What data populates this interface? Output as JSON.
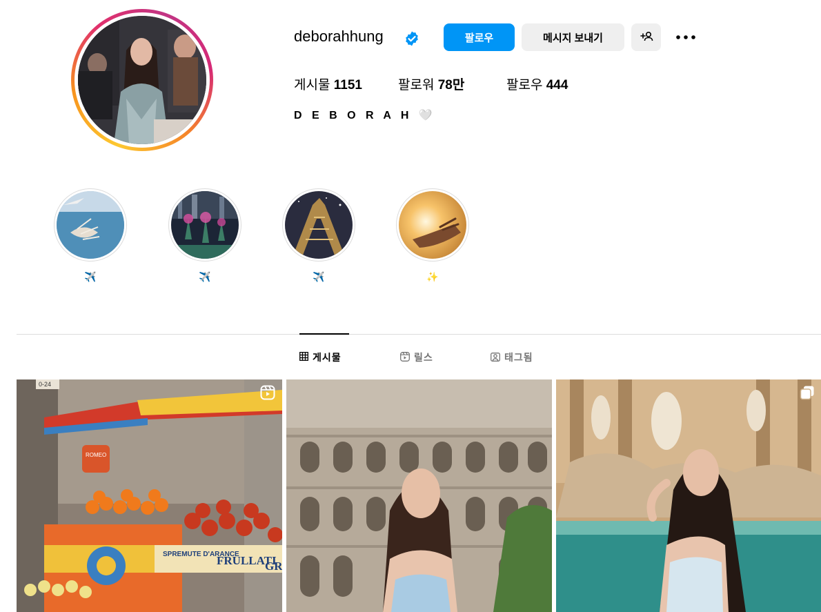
{
  "profile": {
    "username": "deborahhung",
    "display_name": "D E B O R A H 🤍",
    "verified": true,
    "buttons": {
      "follow": "팔로우",
      "message": "메시지 보내기"
    },
    "stats": {
      "posts_label": "게시물",
      "posts_value": "1151",
      "followers_label": "팔로워",
      "followers_value": "78만",
      "following_label": "팔로우",
      "following_value": "444"
    }
  },
  "highlights": [
    {
      "label": "✈️",
      "image": "aerial-palm-island"
    },
    {
      "label": "✈️",
      "image": "gardens-by-the-bay-night"
    },
    {
      "label": "✈️",
      "image": "eiffel-tower-night"
    },
    {
      "label": "✨",
      "image": "hand-in-sunlight"
    }
  ],
  "tabs": [
    {
      "label": "게시물",
      "icon": "grid-icon",
      "active": true
    },
    {
      "label": "릴스",
      "icon": "reels-icon",
      "active": false
    },
    {
      "label": "태그됨",
      "icon": "tagged-icon",
      "active": false
    }
  ],
  "posts": [
    {
      "type": "reel",
      "image": "fruit-cart-street",
      "sign_text_1": "SPREMUTE D'ARANCE",
      "sign_text_2": "FRULLATI",
      "sign_text_3": "GRA",
      "tag": "ROMEO",
      "street_number": "0-24"
    },
    {
      "type": "photo",
      "image": "colosseum-portrait"
    },
    {
      "type": "carousel",
      "image": "trevi-fountain-portrait"
    }
  ],
  "colors": {
    "accent": "#0095f6",
    "button_bg": "#efefef",
    "divider": "#dbdbdb",
    "muted_text": "#737373"
  }
}
